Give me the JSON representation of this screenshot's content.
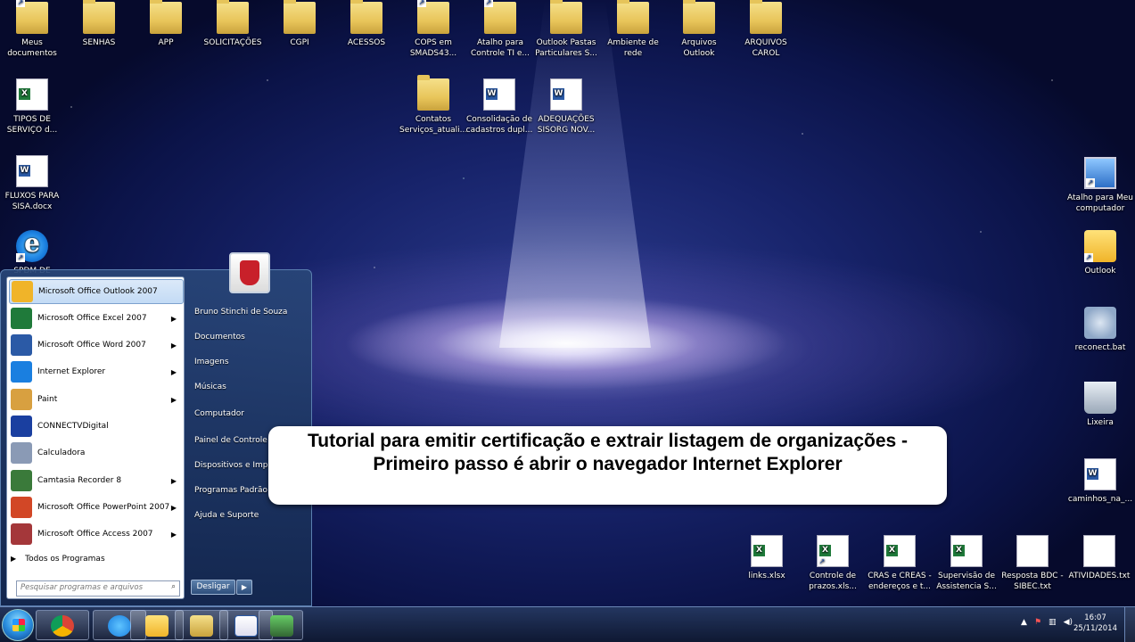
{
  "desktop": {
    "top_row": [
      {
        "label": "Meus documentos",
        "icon": "folder-icon"
      },
      {
        "label": "SENHAS",
        "icon": "folder-icon"
      },
      {
        "label": "APP",
        "icon": "folder-icon"
      },
      {
        "label": "SOLICITAÇÕES",
        "icon": "folder-icon"
      },
      {
        "label": "CGPI",
        "icon": "folder-icon"
      },
      {
        "label": "ACESSOS",
        "icon": "folder-icon"
      },
      {
        "label": "COPS em SMADS43...",
        "icon": "folder-shortcut-icon"
      },
      {
        "label": "Atalho para Controle TI e...",
        "icon": "folder-shortcut-icon"
      },
      {
        "label": "Outlook Pastas Particulares S...",
        "icon": "folder-icon"
      },
      {
        "label": "Ambiente de rede",
        "icon": "folder-icon"
      },
      {
        "label": "Arquivos Outlook",
        "icon": "folder-icon"
      },
      {
        "label": "ARQUIVOS CAROL",
        "icon": "folder-icon"
      }
    ],
    "second_row": [
      {
        "label": "Contatos Serviços_atuali...",
        "icon": "folder-icon"
      },
      {
        "label": "Consolidação de cadastros dupl...",
        "icon": "word-document-icon"
      },
      {
        "label": "ADEQUAÇÕES SISORG NOV...",
        "icon": "word-document-icon"
      }
    ],
    "left_column": [
      {
        "label": "TIPOS DE SERVIÇO d...",
        "icon": "excel-document-icon"
      },
      {
        "label": "FLUXOS PARA SISA.docx",
        "icon": "word-document-icon"
      },
      {
        "label": "SPDM DE",
        "icon": "internet-explorer-icon"
      }
    ],
    "right_column": [
      {
        "label": "Atalho para Meu computador",
        "icon": "computer-shortcut-icon"
      },
      {
        "label": "Outlook",
        "icon": "outlook-icon"
      },
      {
        "label": "reconect.bat",
        "icon": "batch-file-icon"
      },
      {
        "label": "Lixeira",
        "icon": "recycle-bin-icon"
      },
      {
        "label": "caminhos_na_...",
        "icon": "word-document-icon"
      }
    ],
    "bottom_row": [
      {
        "label": "links.xlsx",
        "icon": "excel-document-icon"
      },
      {
        "label": "Controle de prazos.xls...",
        "icon": "excel-document-icon"
      },
      {
        "label": "CRAS e CREAS - endereços e t...",
        "icon": "excel-document-icon"
      },
      {
        "label": "Supervisão de Assistencia S...",
        "icon": "excel-document-icon"
      },
      {
        "label": "Resposta BDC - SIBEC.txt",
        "icon": "text-file-icon"
      },
      {
        "label": "ATIVIDADES.txt",
        "icon": "text-file-icon"
      }
    ]
  },
  "start_menu": {
    "programs": [
      {
        "label": "Microsoft Office Outlook 2007",
        "has_submenu": false,
        "icon": "outlook-icon",
        "color": "#f0b429"
      },
      {
        "label": "Microsoft Office Excel 2007",
        "has_submenu": true,
        "icon": "excel-icon",
        "color": "#1f7a3a"
      },
      {
        "label": "Microsoft Office Word 2007",
        "has_submenu": true,
        "icon": "word-icon",
        "color": "#2b5aa6"
      },
      {
        "label": "Internet Explorer",
        "has_submenu": true,
        "icon": "internet-explorer-icon",
        "color": "#1a7fe0"
      },
      {
        "label": "Paint",
        "has_submenu": true,
        "icon": "paint-icon",
        "color": "#d8a040"
      },
      {
        "label": "CONNECTVDigital",
        "has_submenu": false,
        "icon": "connectv-icon",
        "color": "#1a3fa0"
      },
      {
        "label": "Calculadora",
        "has_submenu": false,
        "icon": "calculator-icon",
        "color": "#8a9ab5"
      },
      {
        "label": "Camtasia Recorder 8",
        "has_submenu": true,
        "icon": "camtasia-icon",
        "color": "#3a7a3a"
      },
      {
        "label": "Microsoft Office PowerPoint 2007",
        "has_submenu": true,
        "icon": "powerpoint-icon",
        "color": "#d24726"
      },
      {
        "label": "Microsoft Office Access 2007",
        "has_submenu": true,
        "icon": "access-icon",
        "color": "#a4373a"
      }
    ],
    "all_programs": "Todos os Programas",
    "search_placeholder": "Pesquisar programas e arquivos",
    "right_items": [
      "Bruno Stinchi de Souza",
      "Documentos",
      "Imagens",
      "Músicas",
      "Computador",
      "Painel de Controle",
      "Dispositivos e Impre",
      "Programas Padrão",
      "Ajuda e Suporte"
    ],
    "shutdown_label": "Desligar"
  },
  "caption": {
    "text": "Tutorial para emitir certificação e extrair listagem de organizações - Primeiro passo é abrir o navegador Internet Explorer"
  },
  "taskbar": {
    "buttons": [
      {
        "name": "chrome",
        "icon": "chrome-icon"
      },
      {
        "name": "internet-explorer",
        "icon": "internet-explorer-icon"
      },
      {
        "name": "outlook",
        "icon": "outlook-icon"
      },
      {
        "name": "explorer",
        "icon": "folder-icon"
      },
      {
        "name": "word",
        "icon": "word-icon"
      },
      {
        "name": "camtasia",
        "icon": "camtasia-icon"
      }
    ],
    "time": "16:07",
    "date": "25/11/2014"
  }
}
